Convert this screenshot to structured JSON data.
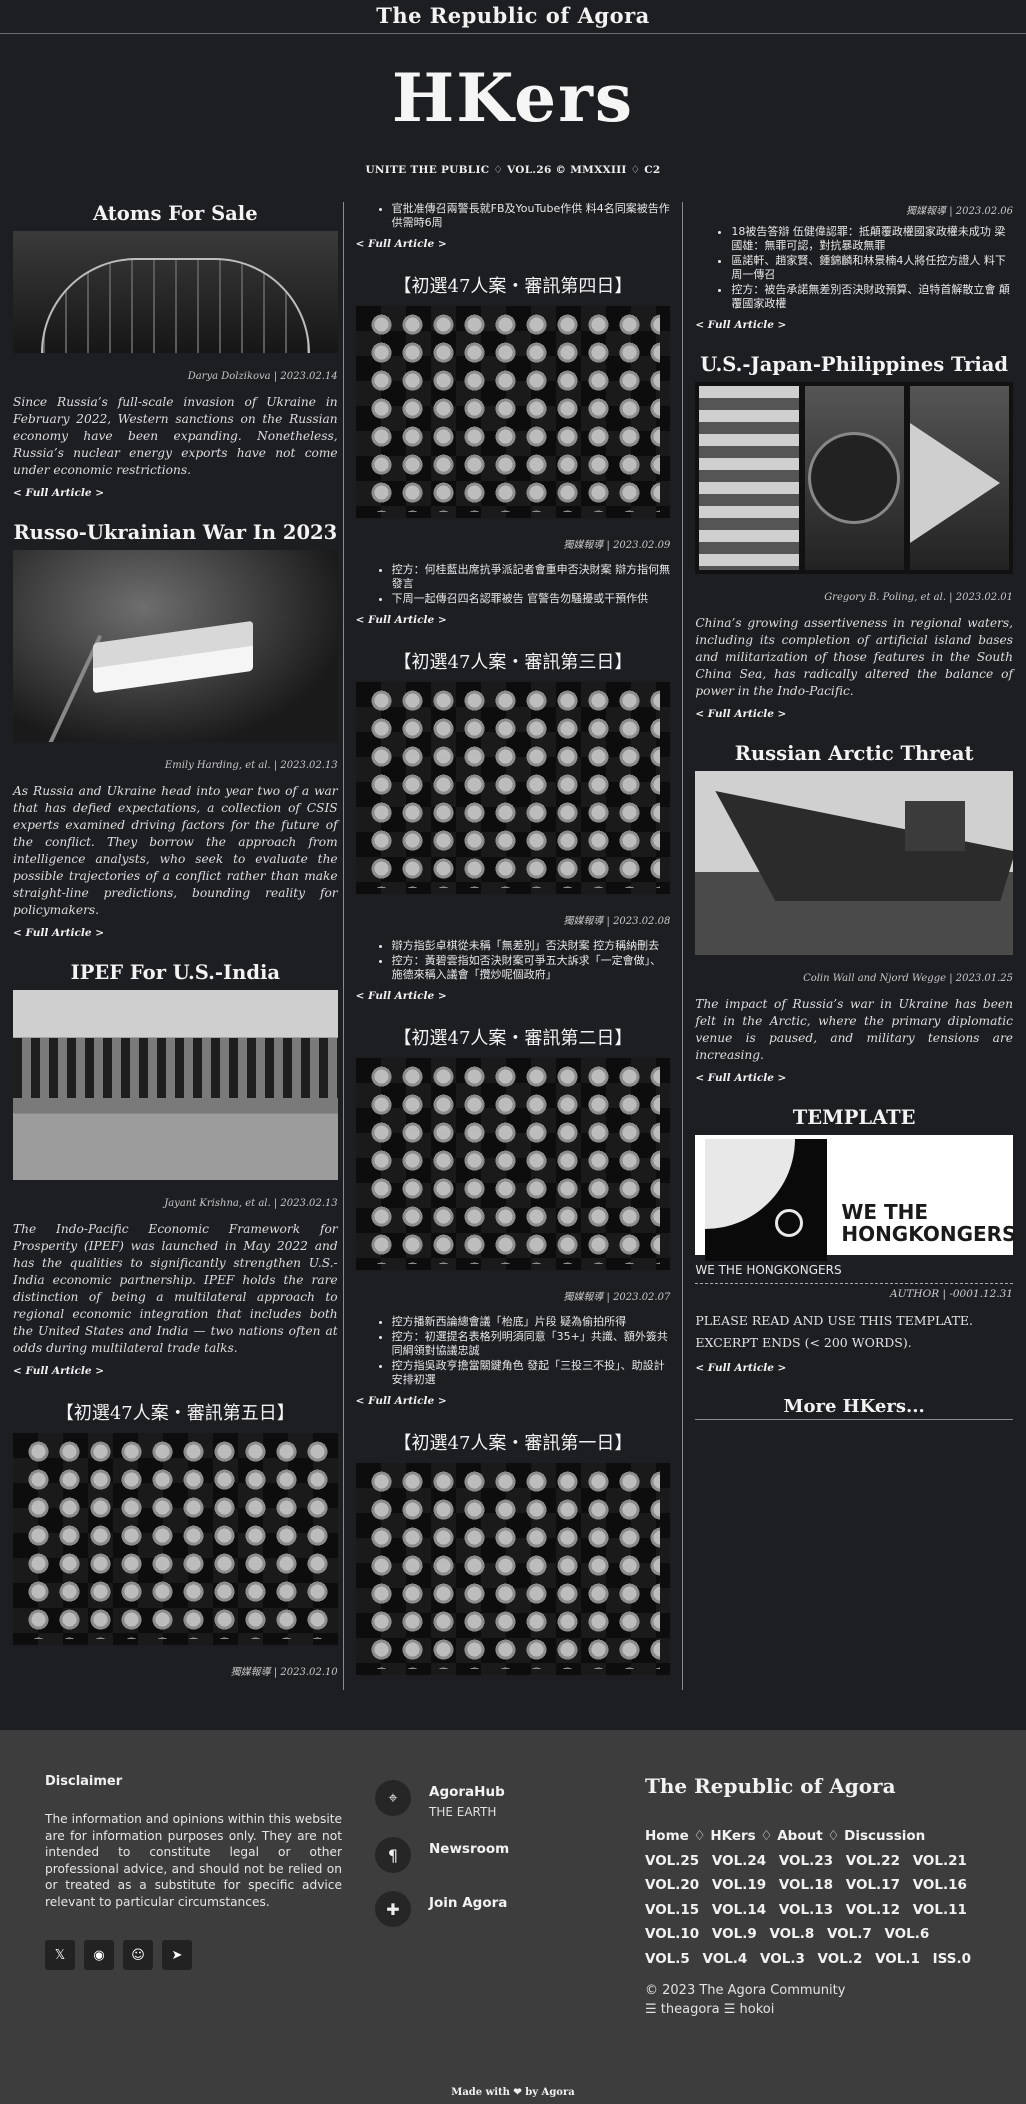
{
  "site_name": "The Republic of Agora",
  "brand": "HKers",
  "tagline": "UNITE THE PUBLIC ♢ VOL.26 © MMXXIII ♢ C2",
  "full_article": "< Full Article >",
  "left": {
    "atoms": {
      "title": "Atoms For Sale",
      "byline": "Darya Dolzikova | 2023.02.14",
      "excerpt": "Since Russia’s full-scale invasion of Ukraine in February 2022, Western sanctions on the Russian economy have been expanding. Nonetheless, Russia’s nuclear energy exports have not come under economic restrictions."
    },
    "war": {
      "title": "Russo-Ukrainian War In 2023",
      "byline": "Emily Harding, et al. | 2023.02.13",
      "excerpt": "As Russia and Ukraine head into year two of a war that has defied expectations, a collection of CSIS experts examined driving factors for the future of the conflict. They borrow the approach from intelligence analysts, who seek to evaluate the possible trajectories of a conflict rather than make straight-line predictions, bounding reality for policymakers."
    },
    "ipef": {
      "title": "IPEF For U.S.-India",
      "byline": "Jayant Krishna, et al. | 2023.02.13",
      "excerpt": "The Indo-Pacific Economic Framework for Prosperity (IPEF) was launched in May 2022 and has the qualities to significantly strengthen U.S.-India economic partnership. IPEF holds the rare distinction of being a multilateral approach to regional economic integration that includes both the United States and India — two nations often at odds during multilateral trade talks."
    },
    "day5": {
      "title": "【初選47人案・審訊第五日】",
      "byline": "獨媒報導 | 2023.02.10"
    }
  },
  "mid": {
    "top_bullets": [
      "官批准傳召兩警長就FB及YouTube作供 料4名同案被告作供需時6周"
    ],
    "day4": {
      "title": "【初選47人案・審訊第四日】",
      "byline": "獨媒報導 | 2023.02.09",
      "bullets": [
        "控方：何桂藍出席抗爭派記者會重申否決財案 辯方指何無發言",
        "下周一起傳召四名認罪被告 官警告勿騷擾或干預作供"
      ]
    },
    "day3": {
      "title": "【初選47人案・審訊第三日】",
      "byline": "獨媒報導 | 2023.02.08",
      "bullets": [
        "辯方指彭卓棋從未稱「無差別」否決財案 控方稱納刪去",
        "控方：黃碧雲指如否決財案可爭五大訴求「一定會做」、施德來稱入議會「攬炒呢個政府」"
      ]
    },
    "day2": {
      "title": "【初選47人案・審訊第二日】",
      "byline": "獨媒報導 | 2023.02.07",
      "bullets": [
        "控方播新西論總會議「枱底」片段 疑為偷拍所得",
        "控方：初選提名表格列明須同意「35+」共識、額外簽共同綱領對協議忠誠",
        "控方指吳政亨擔當關鍵角色 發起「三投三不投」、助設計安排初選"
      ]
    },
    "day1": {
      "title": "【初選47人案・審訊第一日】"
    }
  },
  "right": {
    "top": {
      "byline": "獨媒報導 | 2023.02.06",
      "bullets": [
        "18被告答辯 伍健偉認罪：抵顛覆政權國家政權未成功 梁國雄：無罪可認，對抗暴政無罪",
        "區諾軒、趙家賢、鍾錦麟和林景楠4人將任控方證人 料下周一傳召",
        "控方：被告承諾無差別否決財政預算、迫特首解散立會 顛覆國家政權"
      ]
    },
    "triad": {
      "title": "U.S.-Japan-Philippines Triad",
      "byline": "Gregory B. Poling, et al. | 2023.02.01",
      "excerpt": "China’s growing assertiveness in regional waters, including its completion of artificial island bases and militarization of those features in the South China Sea, has radically altered the balance of power in the Indo-Pacific."
    },
    "arctic": {
      "title": "Russian Arctic Threat",
      "byline": "Colin Wall and Njord Wegge | 2023.01.25",
      "excerpt": "The impact of Russia’s war in Ukraine has been felt in the Arctic, where the primary diplomatic venue is paused, and military tensions are increasing."
    },
    "template": {
      "title": "TEMPLATE",
      "image_text": "WE THE HONGKONGERS",
      "caption": "WE THE HONGKONGERS",
      "byline": "AUTHOR | -0001.12.31",
      "line1": "PLEASE READ AND USE THIS TEMPLATE.",
      "line2": "EXCERPT ENDS (< 200 WORDS)."
    },
    "more_hkers": "More HKers..."
  },
  "footer": {
    "disclaimer_title": "Disclaimer",
    "disclaimer_text": "The information and opinions within this website are for information purposes only. They are not intended to constitute legal or other professional advice, and should not be relied on or treated as a substitute for specific advice relevant to particular circumstances.",
    "social_icons": [
      "twitter-icon",
      "github-icon",
      "reddit-icon",
      "telegram-icon"
    ],
    "links": [
      {
        "label": "AgoraHub",
        "sub": "THE EARTH",
        "icon": "map-pin-icon"
      },
      {
        "label": "Newsroom",
        "sub": "",
        "icon": "paragraph-icon"
      },
      {
        "label": "Join Agora",
        "sub": "",
        "icon": "puzzle-icon"
      }
    ],
    "site_name": "The Republic of Agora",
    "nav": [
      "Home",
      "HKers",
      "About",
      "Discussion"
    ],
    "volumes": [
      "VOL.25",
      "VOL.24",
      "VOL.23",
      "VOL.22",
      "VOL.21",
      "VOL.20",
      "VOL.19",
      "VOL.18",
      "VOL.17",
      "VOL.16",
      "VOL.15",
      "VOL.14",
      "VOL.13",
      "VOL.12",
      "VOL.11",
      "VOL.10",
      "VOL.9",
      "VOL.8",
      "VOL.7",
      "VOL.6",
      "VOL.5",
      "VOL.4",
      "VOL.3",
      "VOL.2",
      "VOL.1",
      "ISS.0"
    ],
    "copyright": "© 2023 The Agora Community",
    "community_links": "☰ theagora ☰ hokoi",
    "made_with": "Made with ❤ by Agora"
  },
  "colors": {
    "background": "#1d1e21",
    "footer": "#3d3d3d",
    "text": "#e6e6e6"
  }
}
